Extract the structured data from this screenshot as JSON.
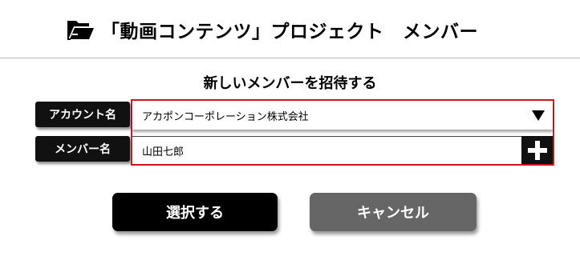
{
  "header": {
    "title": "「動画コンテンツ」プロジェクト　メンバー",
    "icon": "folder-open-icon"
  },
  "invite": {
    "section_title": "新しいメンバーを招待する",
    "account_label": "アカウント名",
    "account_value": "アカポンコーポレーション株式会社",
    "member_label": "メンバー名",
    "member_value": "山田七郎"
  },
  "buttons": {
    "select_label": "選択する",
    "cancel_label": "キャンセル"
  },
  "colors": {
    "highlight_border": "#d0121b",
    "primary_button": "#000000",
    "secondary_button": "#666666"
  }
}
